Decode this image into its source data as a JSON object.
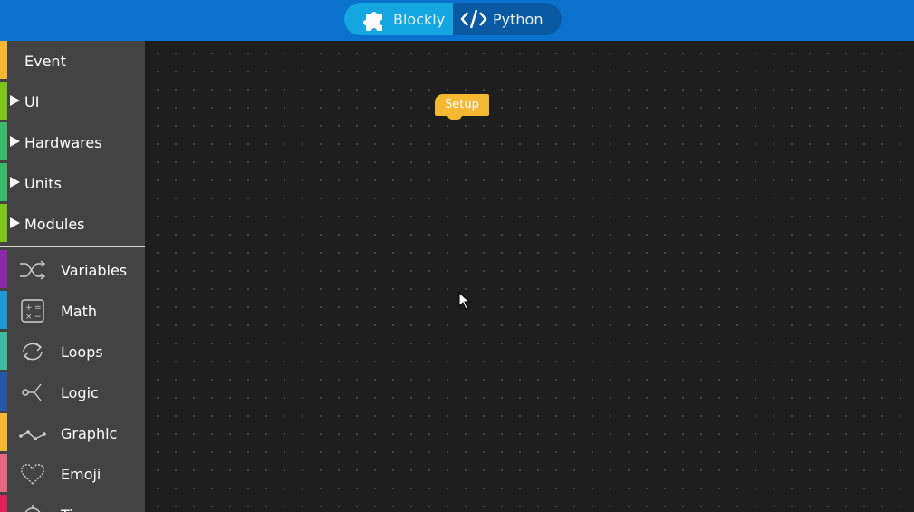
{
  "header": {
    "tabs": [
      {
        "label": "Blockly",
        "icon": "puzzle-icon",
        "active": true
      },
      {
        "label": "Python",
        "icon": "code-icon",
        "active": false
      }
    ]
  },
  "sidebar": {
    "categories": [
      {
        "label": "Event",
        "color": "#f6b830",
        "expandable": false
      },
      {
        "label": "UI",
        "color": "#7cc61a",
        "expandable": true
      },
      {
        "label": "Hardwares",
        "color": "#3aba6b",
        "expandable": true
      },
      {
        "label": "Units",
        "color": "#3aba6b",
        "expandable": true
      },
      {
        "label": "Modules",
        "color": "#7cc61a",
        "expandable": true
      },
      {
        "label": "Variables",
        "color": "#8a2aa8",
        "icon": "shuffle-icon"
      },
      {
        "label": "Math",
        "color": "#1a9ad6",
        "icon": "calculator-icon"
      },
      {
        "label": "Loops",
        "color": "#3cbca0",
        "icon": "loop-icon"
      },
      {
        "label": "Logic",
        "color": "#2656a8",
        "icon": "branch-icon"
      },
      {
        "label": "Graphic",
        "color": "#f6b830",
        "icon": "graph-icon"
      },
      {
        "label": "Emoji",
        "color": "#e8667e",
        "icon": "heart-icon"
      },
      {
        "label": "Ti",
        "color": "#e0205a",
        "icon": "timer-icon"
      }
    ]
  },
  "workspace": {
    "blocks": [
      {
        "label": "Setup",
        "color": "#f6b830"
      }
    ]
  },
  "colors": {
    "topbar": "#0a72cc",
    "toggle_active": "#14a6e0",
    "sidebar": "#434343",
    "workspace": "#1e1e1e"
  }
}
